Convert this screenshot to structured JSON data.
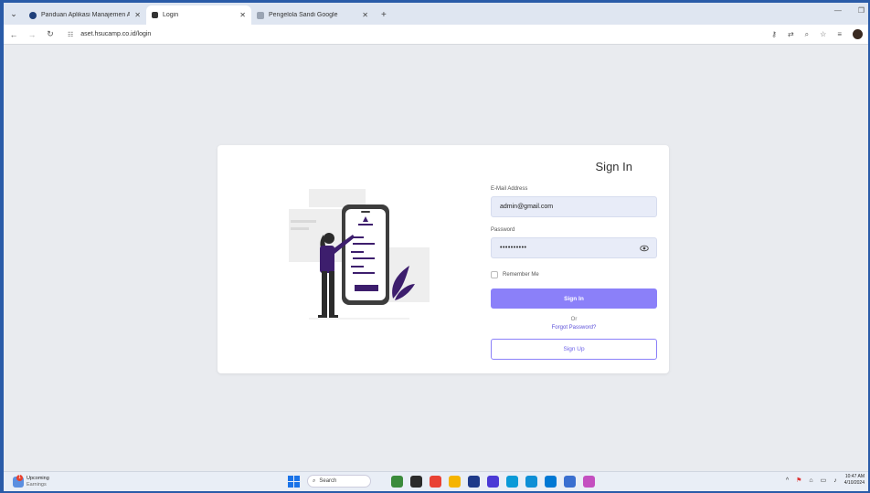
{
  "browser": {
    "tabs": [
      {
        "title": "Panduan Aplikasi Manajemen A",
        "favicon_color": "#1f3f7a",
        "active": false
      },
      {
        "title": "Login",
        "favicon_color": "#333333",
        "active": true
      },
      {
        "title": "Pengelola Sandi Google",
        "favicon_color": "#9aa4b3",
        "active": false
      }
    ],
    "url": "aset.hsucamp.co.id/login",
    "window_controls": [
      "—",
      "❐"
    ]
  },
  "login": {
    "title": "Sign In",
    "email_label": "E-Mail Address",
    "email_value": "admin@gmail.com",
    "password_label": "Password",
    "password_value": "••••••••••",
    "remember_label": "Remember Me",
    "signin_button": "Sign In",
    "or_text": "Or",
    "forgot_link": "Forgot Password?",
    "signup_button": "Sign Up",
    "accent_color": "#8b80f9"
  },
  "taskbar": {
    "weather_title": "Upcoming",
    "weather_sub": "Earnings",
    "weather_badge": "1",
    "search_placeholder": "Search",
    "clock_time": "10:47 AM",
    "clock_date": "4/10/2024",
    "apps": [
      {
        "name": "app-pin-1",
        "color": "#3b8b3b"
      },
      {
        "name": "app-pin-2",
        "color": "#2b2b2b"
      },
      {
        "name": "app-pin-3",
        "color": "#e94235"
      },
      {
        "name": "app-pin-4",
        "color": "#f5b400"
      },
      {
        "name": "app-pin-5",
        "color": "#1e3a8a"
      },
      {
        "name": "app-pin-6",
        "color": "#4a3ad6"
      },
      {
        "name": "app-pin-7",
        "color": "#0a9ad8"
      },
      {
        "name": "app-pin-8",
        "color": "#0e8fd6"
      },
      {
        "name": "app-pin-9",
        "color": "#0078d4"
      },
      {
        "name": "app-pin-10",
        "color": "#3a6fd0"
      },
      {
        "name": "app-pin-11",
        "color": "#c44fc0"
      }
    ]
  }
}
